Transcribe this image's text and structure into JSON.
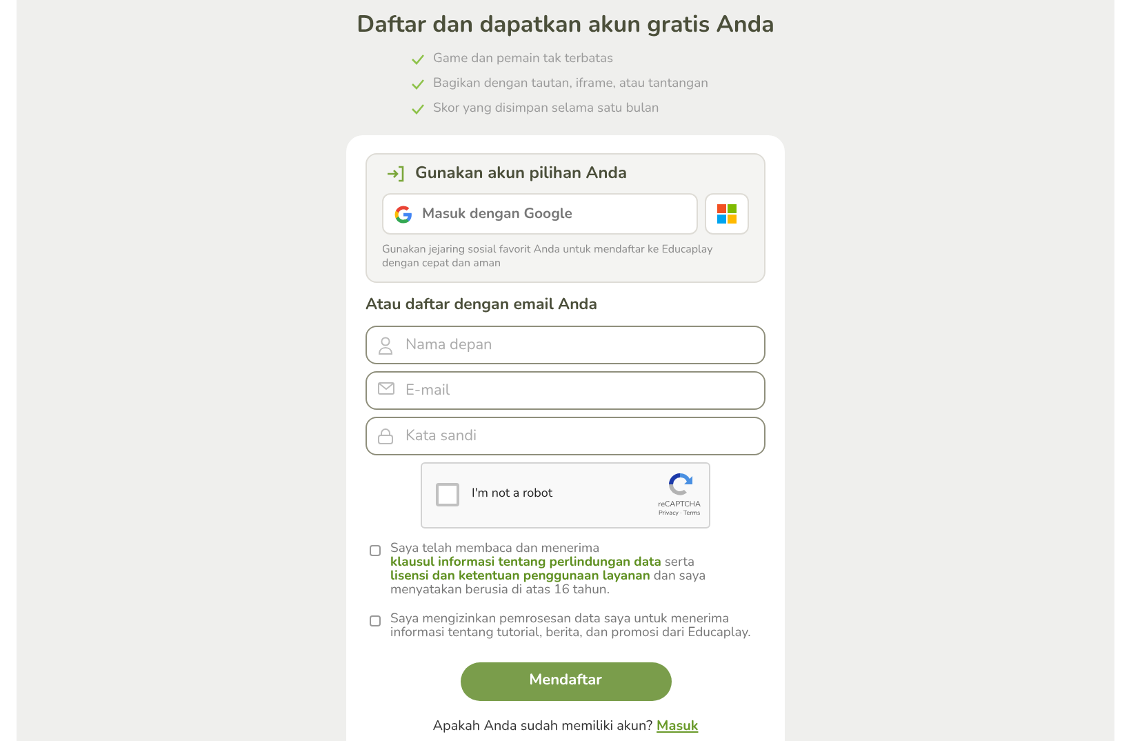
{
  "title": "Daftar dan dapatkan akun gratis Anda",
  "benefits": [
    "Game dan pemain tak terbatas",
    "Bagikan dengan tautan, iframe, atau tantangan",
    "Skor yang disimpan selama satu bulan"
  ],
  "social": {
    "title": "Gunakan akun pilihan Anda",
    "google_button": "Masuk dengan Google",
    "note": "Gunakan jejaring sosial favorit Anda untuk mendaftar ke Educaplay dengan cepat dan aman"
  },
  "email_section": {
    "title": "Atau daftar dengan email Anda",
    "fields": [
      {
        "kind": "name",
        "placeholder": "Nama depan"
      },
      {
        "kind": "email",
        "placeholder": "E-mail"
      },
      {
        "kind": "password",
        "placeholder": "Kata sandi"
      }
    ]
  },
  "captcha": {
    "label": "I'm not a robot",
    "checked": false,
    "brand": "reCAPTCHA",
    "links": "Privacy · Terms"
  },
  "consents": [
    {
      "checked": false,
      "parts": [
        {
          "kind": "text",
          "text": "Saya telah membaca dan menerima "
        },
        {
          "kind": "link",
          "text": "klausul informasi tentang perlindungan data"
        },
        {
          "kind": "text",
          "text": " serta "
        },
        {
          "kind": "link",
          "text": "lisensi dan ketentuan penggunaan layanan"
        },
        {
          "kind": "text",
          "text": " dan saya menyatakan berusia di atas 16 tahun."
        }
      ]
    },
    {
      "checked": false,
      "parts": [
        {
          "kind": "text",
          "text": "Saya mengizinkan pemrosesan data saya untuk menerima informasi tentang tutorial, berita, dan promosi dari Educaplay."
        }
      ]
    }
  ],
  "submit_button": "Mendaftar",
  "login_prompt": {
    "text": "Apakah Anda sudah memiliki akun?",
    "link": "Masuk"
  }
}
